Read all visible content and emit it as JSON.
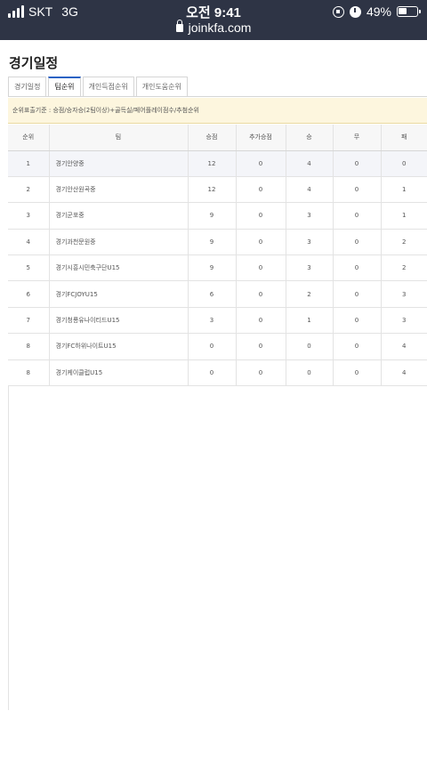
{
  "status_bar": {
    "carrier": "SKT",
    "network": "3G",
    "time": "오전 9:41",
    "url": "joinkfa.com",
    "battery_percent": "49%",
    "battery_level": 0.49
  },
  "page": {
    "title": "경기일정"
  },
  "tabs": [
    {
      "label": "경기일정",
      "active": false
    },
    {
      "label": "팀순위",
      "active": true
    },
    {
      "label": "개인득점순위",
      "active": false
    },
    {
      "label": "개인도움순위",
      "active": false
    }
  ],
  "notice": "순위표출기준 : 승점/승자승(2팀이상)+골득실/페어플레이점수/추첨순위",
  "table": {
    "headers": [
      "순위",
      "팀",
      "승점",
      "추가승점",
      "승",
      "무",
      "패"
    ],
    "rows": [
      [
        "1",
        "경기안양중",
        "12",
        "0",
        "4",
        "0",
        "0"
      ],
      [
        "2",
        "경기안산원곡중",
        "12",
        "0",
        "4",
        "0",
        "1"
      ],
      [
        "3",
        "경기군포중",
        "9",
        "0",
        "3",
        "0",
        "1"
      ],
      [
        "4",
        "경기과천문원중",
        "9",
        "0",
        "3",
        "0",
        "2"
      ],
      [
        "5",
        "경기시흥시민축구단U15",
        "9",
        "0",
        "3",
        "0",
        "2"
      ],
      [
        "6",
        "경기FCJOYU15",
        "6",
        "0",
        "2",
        "0",
        "3"
      ],
      [
        "7",
        "경기청룡유나이티드U15",
        "3",
        "0",
        "1",
        "0",
        "3"
      ],
      [
        "8",
        "경기FC하위나이트U15",
        "0",
        "0",
        "0",
        "0",
        "4"
      ],
      [
        "8",
        "경기케이클럽U15",
        "0",
        "0",
        "0",
        "0",
        "4"
      ]
    ]
  }
}
